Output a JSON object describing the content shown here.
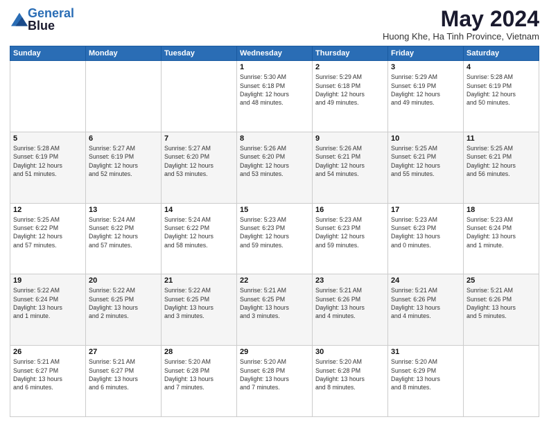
{
  "logo": {
    "line1": "General",
    "line2": "Blue"
  },
  "title": "May 2024",
  "location": "Huong Khe, Ha Tinh Province, Vietnam",
  "days_header": [
    "Sunday",
    "Monday",
    "Tuesday",
    "Wednesday",
    "Thursday",
    "Friday",
    "Saturday"
  ],
  "weeks": [
    [
      {
        "day": "",
        "info": ""
      },
      {
        "day": "",
        "info": ""
      },
      {
        "day": "",
        "info": ""
      },
      {
        "day": "1",
        "info": "Sunrise: 5:30 AM\nSunset: 6:18 PM\nDaylight: 12 hours\nand 48 minutes."
      },
      {
        "day": "2",
        "info": "Sunrise: 5:29 AM\nSunset: 6:18 PM\nDaylight: 12 hours\nand 49 minutes."
      },
      {
        "day": "3",
        "info": "Sunrise: 5:29 AM\nSunset: 6:19 PM\nDaylight: 12 hours\nand 49 minutes."
      },
      {
        "day": "4",
        "info": "Sunrise: 5:28 AM\nSunset: 6:19 PM\nDaylight: 12 hours\nand 50 minutes."
      }
    ],
    [
      {
        "day": "5",
        "info": "Sunrise: 5:28 AM\nSunset: 6:19 PM\nDaylight: 12 hours\nand 51 minutes."
      },
      {
        "day": "6",
        "info": "Sunrise: 5:27 AM\nSunset: 6:19 PM\nDaylight: 12 hours\nand 52 minutes."
      },
      {
        "day": "7",
        "info": "Sunrise: 5:27 AM\nSunset: 6:20 PM\nDaylight: 12 hours\nand 53 minutes."
      },
      {
        "day": "8",
        "info": "Sunrise: 5:26 AM\nSunset: 6:20 PM\nDaylight: 12 hours\nand 53 minutes."
      },
      {
        "day": "9",
        "info": "Sunrise: 5:26 AM\nSunset: 6:21 PM\nDaylight: 12 hours\nand 54 minutes."
      },
      {
        "day": "10",
        "info": "Sunrise: 5:25 AM\nSunset: 6:21 PM\nDaylight: 12 hours\nand 55 minutes."
      },
      {
        "day": "11",
        "info": "Sunrise: 5:25 AM\nSunset: 6:21 PM\nDaylight: 12 hours\nand 56 minutes."
      }
    ],
    [
      {
        "day": "12",
        "info": "Sunrise: 5:25 AM\nSunset: 6:22 PM\nDaylight: 12 hours\nand 57 minutes."
      },
      {
        "day": "13",
        "info": "Sunrise: 5:24 AM\nSunset: 6:22 PM\nDaylight: 12 hours\nand 57 minutes."
      },
      {
        "day": "14",
        "info": "Sunrise: 5:24 AM\nSunset: 6:22 PM\nDaylight: 12 hours\nand 58 minutes."
      },
      {
        "day": "15",
        "info": "Sunrise: 5:23 AM\nSunset: 6:23 PM\nDaylight: 12 hours\nand 59 minutes."
      },
      {
        "day": "16",
        "info": "Sunrise: 5:23 AM\nSunset: 6:23 PM\nDaylight: 12 hours\nand 59 minutes."
      },
      {
        "day": "17",
        "info": "Sunrise: 5:23 AM\nSunset: 6:23 PM\nDaylight: 13 hours\nand 0 minutes."
      },
      {
        "day": "18",
        "info": "Sunrise: 5:23 AM\nSunset: 6:24 PM\nDaylight: 13 hours\nand 1 minute."
      }
    ],
    [
      {
        "day": "19",
        "info": "Sunrise: 5:22 AM\nSunset: 6:24 PM\nDaylight: 13 hours\nand 1 minute."
      },
      {
        "day": "20",
        "info": "Sunrise: 5:22 AM\nSunset: 6:25 PM\nDaylight: 13 hours\nand 2 minutes."
      },
      {
        "day": "21",
        "info": "Sunrise: 5:22 AM\nSunset: 6:25 PM\nDaylight: 13 hours\nand 3 minutes."
      },
      {
        "day": "22",
        "info": "Sunrise: 5:21 AM\nSunset: 6:25 PM\nDaylight: 13 hours\nand 3 minutes."
      },
      {
        "day": "23",
        "info": "Sunrise: 5:21 AM\nSunset: 6:26 PM\nDaylight: 13 hours\nand 4 minutes."
      },
      {
        "day": "24",
        "info": "Sunrise: 5:21 AM\nSunset: 6:26 PM\nDaylight: 13 hours\nand 4 minutes."
      },
      {
        "day": "25",
        "info": "Sunrise: 5:21 AM\nSunset: 6:26 PM\nDaylight: 13 hours\nand 5 minutes."
      }
    ],
    [
      {
        "day": "26",
        "info": "Sunrise: 5:21 AM\nSunset: 6:27 PM\nDaylight: 13 hours\nand 6 minutes."
      },
      {
        "day": "27",
        "info": "Sunrise: 5:21 AM\nSunset: 6:27 PM\nDaylight: 13 hours\nand 6 minutes."
      },
      {
        "day": "28",
        "info": "Sunrise: 5:20 AM\nSunset: 6:28 PM\nDaylight: 13 hours\nand 7 minutes."
      },
      {
        "day": "29",
        "info": "Sunrise: 5:20 AM\nSunset: 6:28 PM\nDaylight: 13 hours\nand 7 minutes."
      },
      {
        "day": "30",
        "info": "Sunrise: 5:20 AM\nSunset: 6:28 PM\nDaylight: 13 hours\nand 8 minutes."
      },
      {
        "day": "31",
        "info": "Sunrise: 5:20 AM\nSunset: 6:29 PM\nDaylight: 13 hours\nand 8 minutes."
      },
      {
        "day": "",
        "info": ""
      }
    ]
  ]
}
